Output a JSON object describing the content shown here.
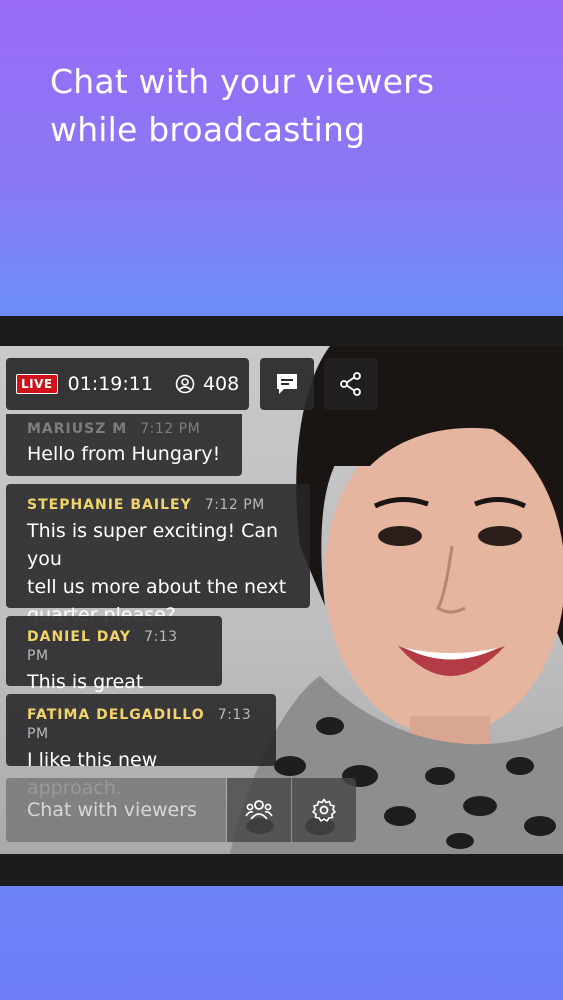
{
  "headline": {
    "line1": "Chat with your viewers",
    "line2": "while broadcasting"
  },
  "stream": {
    "live_label": "LIVE",
    "elapsed": "01:19:11",
    "viewer_count": "408"
  },
  "messages": [
    {
      "author": "MARIUSZ M",
      "time": "7:12 PM",
      "lines": [
        "Hello from Hungary!"
      ]
    },
    {
      "author": "STEPHANIE BAILEY",
      "time": "7:12 PM",
      "lines": [
        "This is super exciting! Can you",
        "tell us more about the next",
        "quarter please?"
      ]
    },
    {
      "author": "DANIEL DAY",
      "time": "7:13 PM",
      "lines": [
        "This is great news!"
      ]
    },
    {
      "author": "FATIMA DELGADILLO",
      "time": "7:13 PM",
      "lines": [
        "I like this new approach."
      ]
    }
  ],
  "chat_input": {
    "placeholder": "Chat with viewers"
  },
  "icons": {
    "viewers": "person-circle-icon",
    "chat": "chat-bubble-icon",
    "share": "share-icon",
    "people": "people-icon",
    "settings": "gear-icon"
  },
  "colors": {
    "live_red": "#d0121a",
    "author_yellow": "#f2d46a",
    "bg_top": "#9a6cf6",
    "bg_bottom": "#6f8cf8"
  }
}
